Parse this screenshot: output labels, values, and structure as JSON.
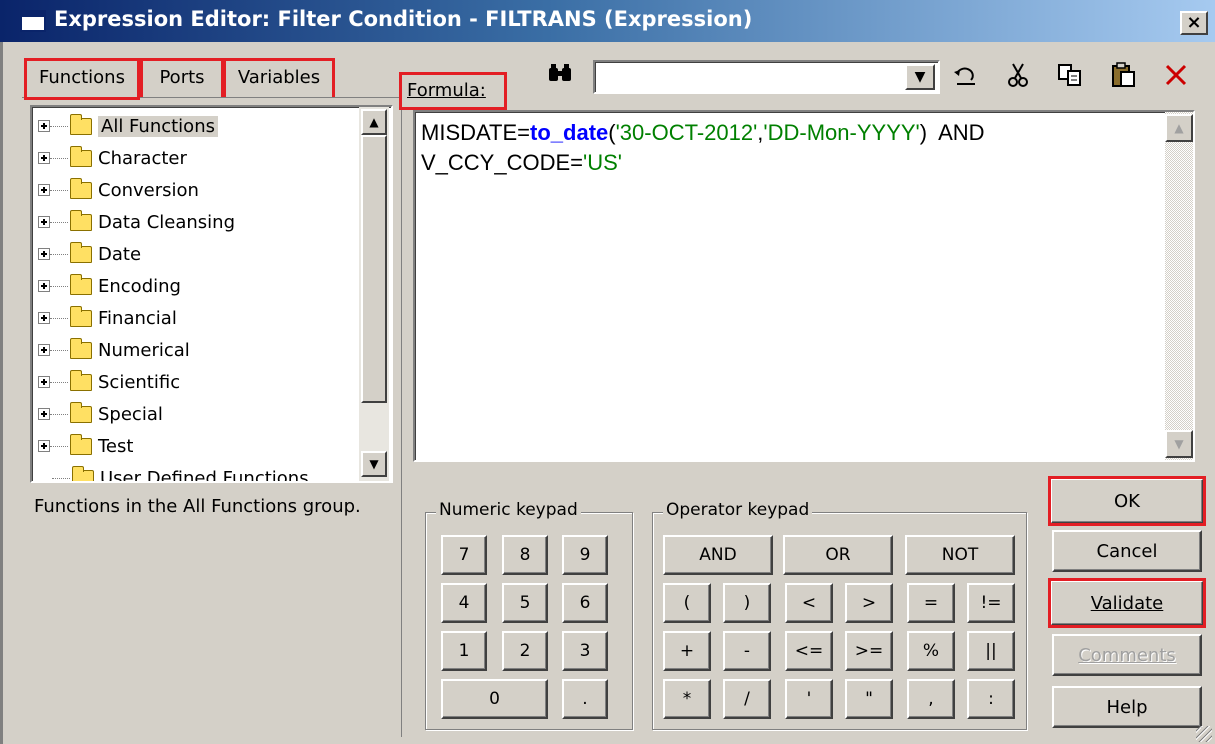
{
  "window": {
    "title": "Expression Editor: Filter Condition - FILTRANS (Expression)",
    "close_glyph": "×"
  },
  "tabs": [
    {
      "label": "Functions"
    },
    {
      "label": "Ports"
    },
    {
      "label": "Variables"
    }
  ],
  "formula_label": "Formula:",
  "search": {
    "value": ""
  },
  "toolbar_icons": [
    "find-icon",
    "undo-icon",
    "cut-icon",
    "copy-icon",
    "paste-icon",
    "delete-icon"
  ],
  "tree": {
    "items": [
      "All Functions",
      "Character",
      "Conversion",
      "Data Cleansing",
      "Date",
      "Encoding",
      "Financial",
      "Numerical",
      "Scientific",
      "Special",
      "Test",
      "User Defined Functions"
    ],
    "selected": "All Functions"
  },
  "description": "Functions in the All Functions group.",
  "formula": {
    "line1_pre": "MISDATE=",
    "line1_fn": "to_date",
    "line1_open": "(",
    "line1_arg1": "'30-OCT-2012'",
    "line1_comma": ",",
    "line1_arg2": "'DD-Mon-YYYY'",
    "line1_post": ")  AND",
    "line2_pre": "V_CCY_CODE=",
    "line2_str": "'US'"
  },
  "numeric_keypad": {
    "title": "Numeric keypad",
    "keys": [
      "7",
      "8",
      "9",
      "4",
      "5",
      "6",
      "1",
      "2",
      "3",
      "0",
      "."
    ]
  },
  "operator_keypad": {
    "title": "Operator keypad",
    "row1": [
      "AND",
      "OR",
      "NOT"
    ],
    "row2": [
      "(",
      ")",
      "<",
      ">",
      "=",
      "!="
    ],
    "row3": [
      "+",
      "-",
      "<=",
      ">=",
      "%",
      "||"
    ],
    "row4": [
      "*",
      "/",
      "'",
      "\"",
      ",",
      ":"
    ]
  },
  "buttons": {
    "ok": "OK",
    "cancel": "Cancel",
    "validate": "Validate",
    "comments": "Comments",
    "help": "Help"
  },
  "colors": {
    "highlight_box": "#e31e24",
    "keyword": "#0000ff",
    "string": "#008000"
  }
}
